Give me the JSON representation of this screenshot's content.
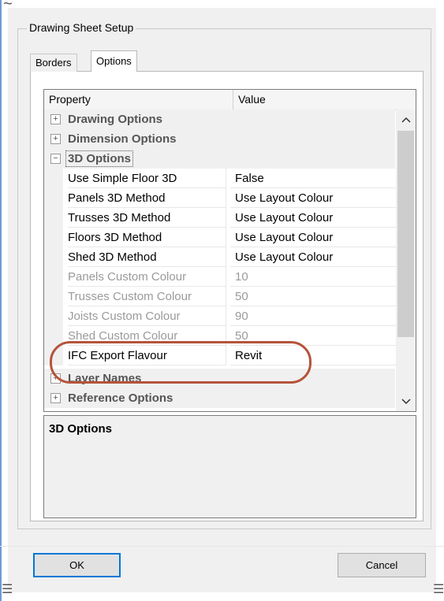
{
  "window": {
    "tilde": "~"
  },
  "groupbox": {
    "title": "Drawing Sheet Setup"
  },
  "tabs": [
    {
      "label": "Borders",
      "active": false
    },
    {
      "label": "Options",
      "active": true
    }
  ],
  "grid": {
    "headers": {
      "property": "Property",
      "value": "Value"
    },
    "categories": {
      "drawing_options": {
        "toggle": "+",
        "label": "Drawing Options"
      },
      "dimension_options": {
        "toggle": "+",
        "label": "Dimension Options"
      },
      "options_3d": {
        "toggle": "−",
        "label": "3D Options"
      },
      "layer_names": {
        "toggle": "+",
        "label": "Layer Names"
      },
      "reference_options": {
        "toggle": "+",
        "label": "Reference Options"
      }
    },
    "rows": [
      {
        "name": "Use Simple Floor 3D",
        "value": "False",
        "enabled": true
      },
      {
        "name": "Panels 3D Method",
        "value": "Use Layout Colour",
        "enabled": true
      },
      {
        "name": "Trusses 3D Method",
        "value": "Use Layout Colour",
        "enabled": true
      },
      {
        "name": "Floors 3D Method",
        "value": "Use Layout Colour",
        "enabled": true
      },
      {
        "name": "Shed 3D Method",
        "value": "Use Layout Colour",
        "enabled": true
      },
      {
        "name": "Panels Custom Colour",
        "value": "10",
        "enabled": false
      },
      {
        "name": "Trusses Custom Colour",
        "value": "50",
        "enabled": false
      },
      {
        "name": "Joists Custom Colour",
        "value": "90",
        "enabled": false
      },
      {
        "name": "Shed Custom Colour",
        "value": "50",
        "enabled": false
      },
      {
        "name": "IFC Export Flavour",
        "value": "Revit",
        "enabled": true
      }
    ],
    "scroll_up_icon": "chevron-up-icon",
    "scroll_down_icon": "chevron-down-icon"
  },
  "description": {
    "title": "3D Options"
  },
  "buttons": {
    "ok": "OK",
    "cancel": "Cancel"
  },
  "highlight_color": "#b5543a",
  "grip_glyph": "☰"
}
